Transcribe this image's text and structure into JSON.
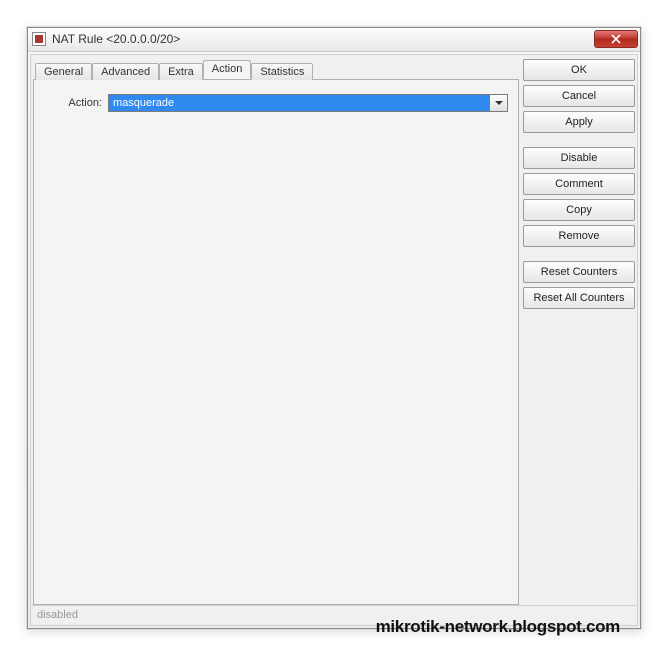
{
  "window": {
    "title": "NAT Rule <20.0.0.0/20>"
  },
  "tabs": [
    {
      "label": "General",
      "active": false
    },
    {
      "label": "Advanced",
      "active": false
    },
    {
      "label": "Extra",
      "active": false
    },
    {
      "label": "Action",
      "active": true
    },
    {
      "label": "Statistics",
      "active": false
    }
  ],
  "form": {
    "action_label": "Action:",
    "action_value": "masquerade"
  },
  "buttons": {
    "ok": "OK",
    "cancel": "Cancel",
    "apply": "Apply",
    "disable": "Disable",
    "comment": "Comment",
    "copy": "Copy",
    "remove": "Remove",
    "reset_counters": "Reset Counters",
    "reset_all_counters": "Reset All Counters"
  },
  "status": {
    "text": "disabled"
  },
  "watermark": "mikrotik-network.blogspot.com"
}
